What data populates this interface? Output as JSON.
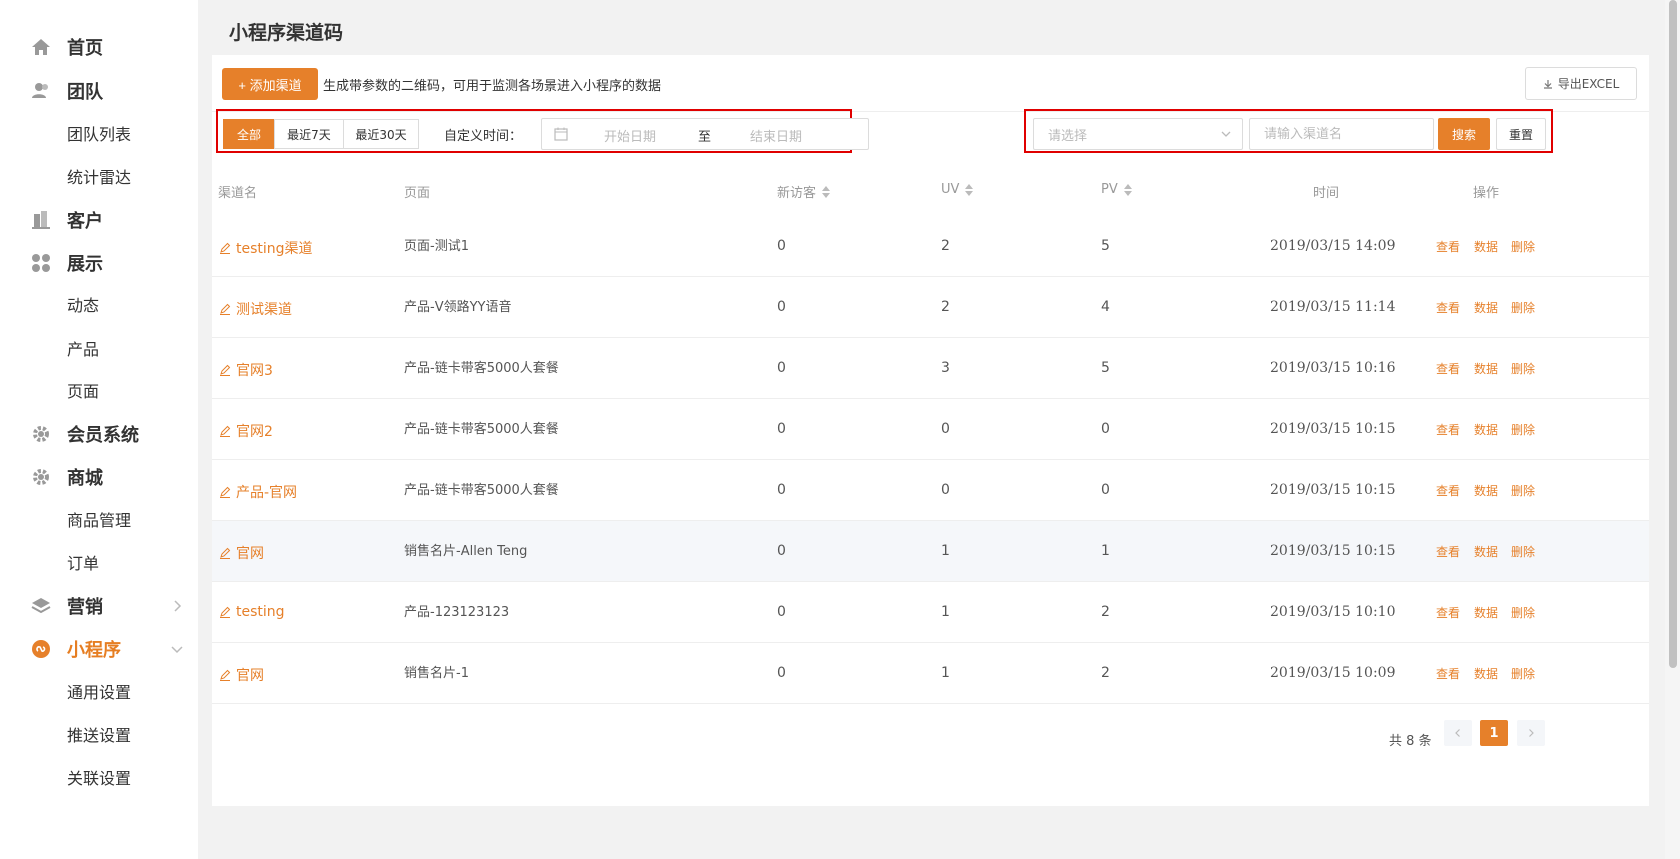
{
  "sidebar": {
    "items": [
      {
        "label": "首页",
        "icon": "home-icon"
      },
      {
        "label": "团队",
        "icon": "users-icon"
      },
      {
        "label": "团队列表"
      },
      {
        "label": "统计雷达"
      },
      {
        "label": "客户",
        "icon": "building-icon"
      },
      {
        "label": "展示",
        "icon": "grid-icon"
      },
      {
        "label": "动态"
      },
      {
        "label": "产品"
      },
      {
        "label": "页面"
      },
      {
        "label": "会员系统",
        "icon": "gear-icon"
      },
      {
        "label": "商城",
        "icon": "gear-icon"
      },
      {
        "label": "商品管理"
      },
      {
        "label": "订单"
      },
      {
        "label": "营销",
        "icon": "layers-icon"
      },
      {
        "label": "小程序",
        "icon": "miniprogram-icon"
      },
      {
        "label": "通用设置"
      },
      {
        "label": "推送设置"
      },
      {
        "label": "关联设置"
      }
    ]
  },
  "page": {
    "title": "小程序渠道码"
  },
  "toolbar": {
    "add_label": "+ 添加渠道",
    "hint": "生成带参数的二维码，可用于监测各场景进入小程序的数据",
    "export_label": "导出EXCEL"
  },
  "filters": {
    "tabs": [
      "全部",
      "最近7天",
      "最近30天"
    ],
    "active_tab": "全部",
    "custom_label": "自定义时间：",
    "start_placeholder": "开始日期",
    "range_sep": "至",
    "end_placeholder": "结束日期",
    "select_placeholder": "请选择",
    "name_placeholder": "请输入渠道名",
    "search_label": "搜索",
    "reset_label": "重置"
  },
  "table": {
    "columns": [
      "渠道名",
      "页面",
      "新访客",
      "UV",
      "PV",
      "时间",
      "操作"
    ],
    "actions": [
      "查看",
      "数据",
      "删除"
    ],
    "rows": [
      {
        "name": "testing渠道",
        "page": "页面-测试1",
        "new_visitors": "0",
        "uv": "2",
        "pv": "5",
        "time": "2019/03/15 14:09"
      },
      {
        "name": "测试渠道",
        "page": "产品-V领路YY语音",
        "new_visitors": "0",
        "uv": "2",
        "pv": "4",
        "time": "2019/03/15 11:14"
      },
      {
        "name": "官网3",
        "page": "产品-链卡带客5000人套餐",
        "new_visitors": "0",
        "uv": "3",
        "pv": "5",
        "time": "2019/03/15 10:16"
      },
      {
        "name": "官网2",
        "page": "产品-链卡带客5000人套餐",
        "new_visitors": "0",
        "uv": "0",
        "pv": "0",
        "time": "2019/03/15 10:15"
      },
      {
        "name": "产品-官网",
        "page": "产品-链卡带客5000人套餐",
        "new_visitors": "0",
        "uv": "0",
        "pv": "0",
        "time": "2019/03/15 10:15"
      },
      {
        "name": "官网",
        "page": "销售名片-Allen Teng",
        "new_visitors": "0",
        "uv": "1",
        "pv": "1",
        "time": "2019/03/15 10:15"
      },
      {
        "name": "testing",
        "page": "产品-123123123",
        "new_visitors": "0",
        "uv": "1",
        "pv": "2",
        "time": "2019/03/15 10:10"
      },
      {
        "name": "官网",
        "page": "销售名片-1",
        "new_visitors": "0",
        "uv": "1",
        "pv": "2",
        "time": "2019/03/15 10:09"
      }
    ]
  },
  "pagination": {
    "total_label": "共 8 条",
    "current_page": "1"
  },
  "colors": {
    "accent": "#e6802a",
    "highlight_box": "#e00000"
  }
}
